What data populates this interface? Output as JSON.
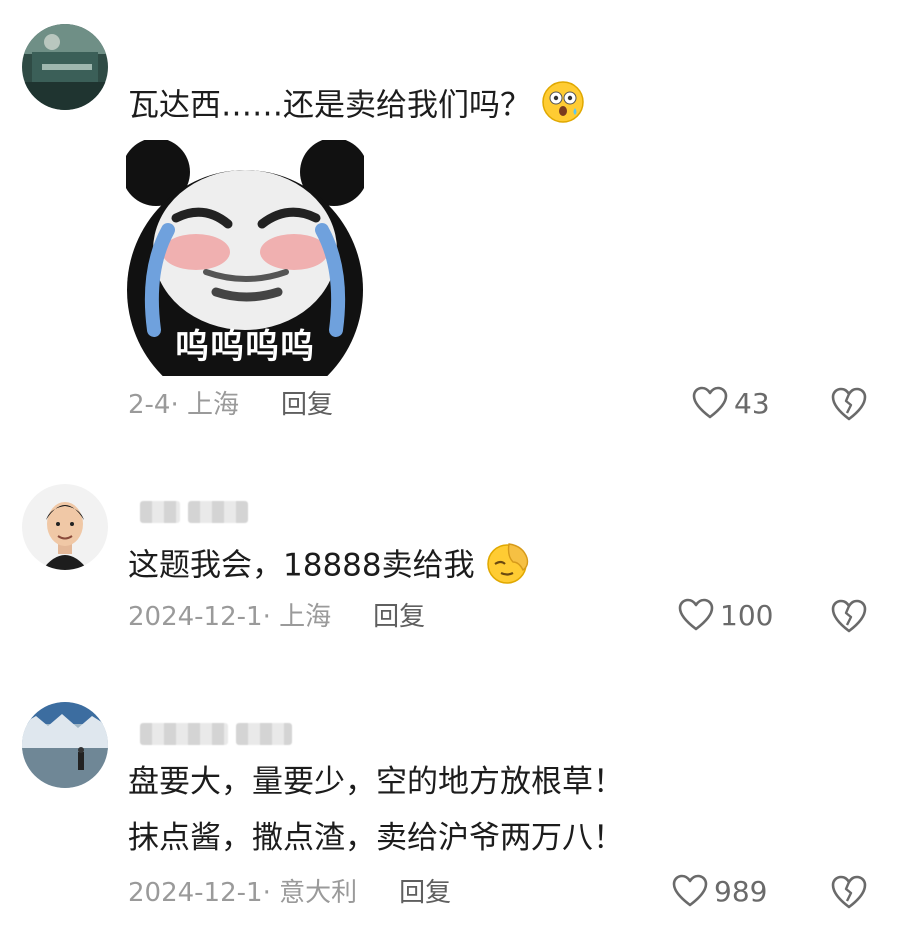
{
  "comments": [
    {
      "text": "瓦达西……还是卖给我们吗？",
      "sticker_caption": "呜呜呜呜",
      "date": "2-4",
      "location": "上海",
      "reply_label": "回复",
      "likes": "43",
      "emoji": "surprised-face-emoji"
    },
    {
      "text": "这题我会，18888卖给我",
      "date": "2024-12-1",
      "location": "上海",
      "reply_label": "回复",
      "likes": "100",
      "emoji": "facepalm-emoji"
    },
    {
      "line1": "盘要大，量要少，空的地方放根草！",
      "line2": "抹点酱，撒点渣，卖给沪爷两万八！",
      "date": "2024-12-1",
      "location": "意大利",
      "reply_label": "回复",
      "likes": "989"
    }
  ],
  "icons": {
    "like": "heart-outline-icon",
    "dislike": "broken-heart-icon"
  },
  "colors": {
    "meta_text": "#9a9a9a",
    "reply_text": "#5f5f5f",
    "primary_text": "#1c1c1c"
  }
}
